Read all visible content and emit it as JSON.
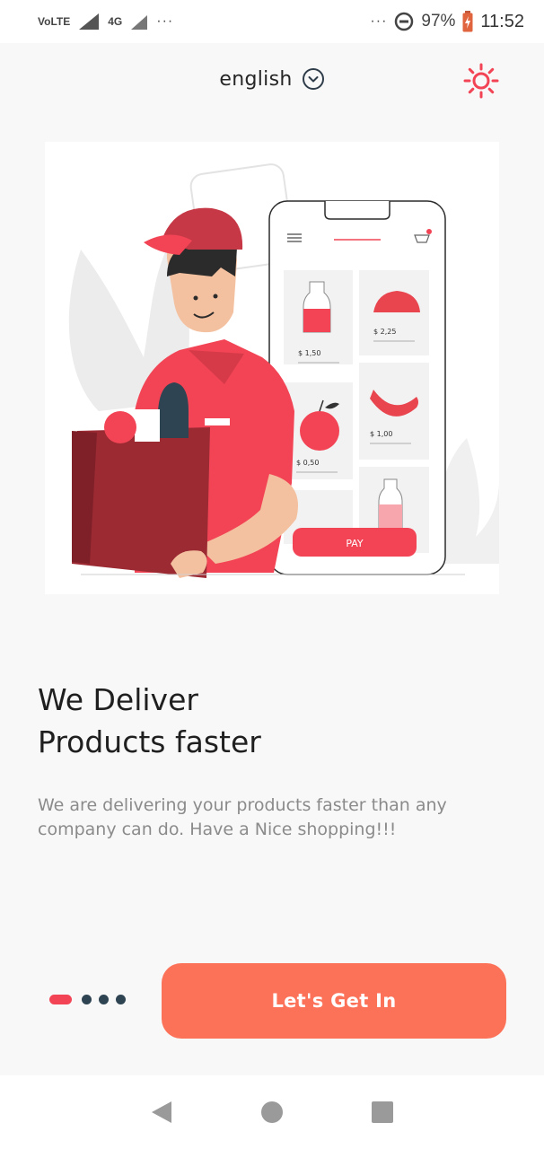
{
  "status_bar": {
    "network_label": "VoLTE",
    "signal_label": "4G",
    "left_dots": "···",
    "right_dots": "···",
    "battery_percent": "97%",
    "time": "11:52"
  },
  "header": {
    "language": "english",
    "icons": {
      "language_dropdown": "chevron-down-circle-icon",
      "theme_toggle": "sun-icon"
    }
  },
  "illustration": {
    "phone": {
      "items": [
        {
          "product": "milk-bottle",
          "price": "$ 1,50"
        },
        {
          "product": "bread",
          "price": "$ 2,25"
        },
        {
          "product": "apple",
          "price": "$ 0,50"
        },
        {
          "product": "banana",
          "price": "$ 1,00"
        },
        {
          "product": "bottle",
          "price": ""
        }
      ],
      "pay_label": "PAY"
    }
  },
  "content": {
    "headline_line1": "We Deliver",
    "headline_line2": "Products faster",
    "description": "We are delivering your products faster than any company can do. Have a Nice shopping!!!"
  },
  "pager": {
    "count": 4,
    "active_index": 0
  },
  "cta": {
    "label": "Let's Get In"
  },
  "nav_bar": {
    "icons": [
      "back-icon",
      "home-icon",
      "recents-icon"
    ]
  },
  "colors": {
    "accent": "#fc7259",
    "brand_red": "#f24455",
    "dark_dot": "#2f4452",
    "background": "#f8f8f8"
  }
}
